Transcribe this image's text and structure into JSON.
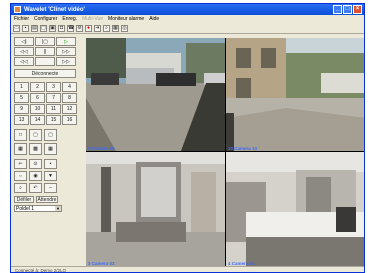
{
  "window": {
    "title": "Wavelet 'Clinet vidéo'"
  },
  "menu": [
    {
      "label": "Fichier",
      "enabled": true
    },
    {
      "label": "Configurer",
      "enabled": true
    },
    {
      "label": "Enreg.",
      "enabled": true
    },
    {
      "label": "Multi-Vue",
      "enabled": false
    },
    {
      "label": "Moniteur alarme",
      "enabled": true
    },
    {
      "label": "Aide",
      "enabled": true
    }
  ],
  "toolbar": [
    "open-icon",
    "save-icon",
    "print-icon",
    "window-icon",
    "lock-icon",
    "camera-icon",
    "phone-icon",
    "settings-icon",
    "record-icon",
    "arrow-icon",
    "search-icon",
    "layout-icon",
    "eye-icon"
  ],
  "playback": {
    "row1": [
      "◁|",
      "|▢",
      "▷"
    ],
    "row2": [
      "◁◁",
      "||",
      "▷▷"
    ],
    "row3": [
      "◁◁",
      "",
      "▷▷"
    ],
    "disconnect_label": "Déconnecte"
  },
  "camera_numbers": [
    "1",
    "2",
    "3",
    "4",
    "5",
    "6",
    "7",
    "8",
    "9",
    "10",
    "11",
    "12",
    "13",
    "14",
    "15",
    "16"
  ],
  "layout_buttons": [
    "1x1",
    "2x2",
    "3x3",
    "4x4-a",
    "4x4-b",
    "4x4-c"
  ],
  "ptz_buttons": [
    "◁▽",
    "⊙",
    "◦",
    "◁▷",
    "◉",
    "▼",
    "🔍",
    "↶",
    "‒"
  ],
  "speed": {
    "slower_label": "Défiler",
    "stop_label": "Attendre"
  },
  "preset": {
    "value": "Poldel 1"
  },
  "cameras": [
    {
      "label": "9 Camera 09"
    },
    {
      "label": "10 Camera 10"
    },
    {
      "label": "3 Camera 03"
    },
    {
      "label": "4 Camera 04"
    }
  ],
  "datetime": "27.07.2003 08:47:15",
  "status": "Connecté à: Demo 2/2LO",
  "colors": {
    "titlebar": "#0a4ed8",
    "camera_label": "#3c6cff",
    "background": "#ece9d8"
  }
}
